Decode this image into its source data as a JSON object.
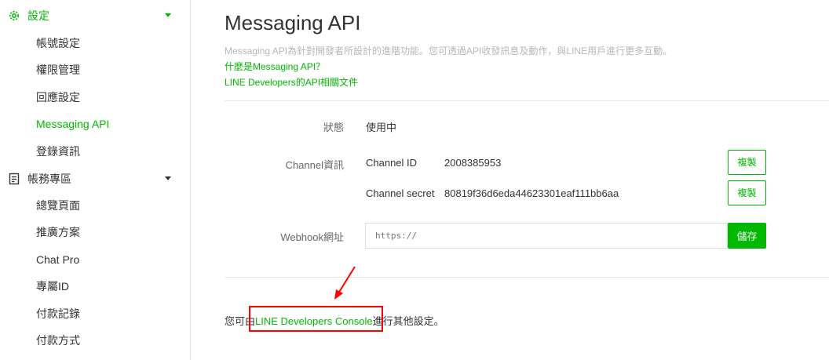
{
  "sidebar": {
    "settings_label": "設定",
    "settings_items": [
      "帳號設定",
      "權限管理",
      "回應設定",
      "Messaging API",
      "登錄資訊"
    ],
    "billing_label": "帳務專區",
    "billing_items": [
      "總覽頁面",
      "推廣方案",
      "Chat Pro",
      "專屬ID",
      "付款記錄",
      "付款方式"
    ]
  },
  "main": {
    "title": "Messaging API",
    "description": "Messaging API為針對開發者所設計的進階功能。您可透過API收發訊息及動作，與LINE用戶進行更多互動。",
    "link_what": "什麼是Messaging API？",
    "link_docs": "LINE Developers的API相關文件",
    "status_label": "狀態",
    "status_value": "使用中",
    "channel_label": "Channel資訊",
    "channel_id_label": "Channel ID",
    "channel_id_value": "2008385953",
    "channel_secret_label": "Channel secret",
    "channel_secret_value": "80819f36d6eda44623301eaf111bb6aa",
    "copy_label": "複製",
    "webhook_label": "Webhook網址",
    "webhook_placeholder": "https://",
    "save_label": "儲存",
    "footer_prefix": "您可由",
    "footer_link": "LINE Developers Console",
    "footer_suffix": "進行其他設定。"
  },
  "colors": {
    "accent": "#00b900",
    "highlight": "#ff0000"
  }
}
